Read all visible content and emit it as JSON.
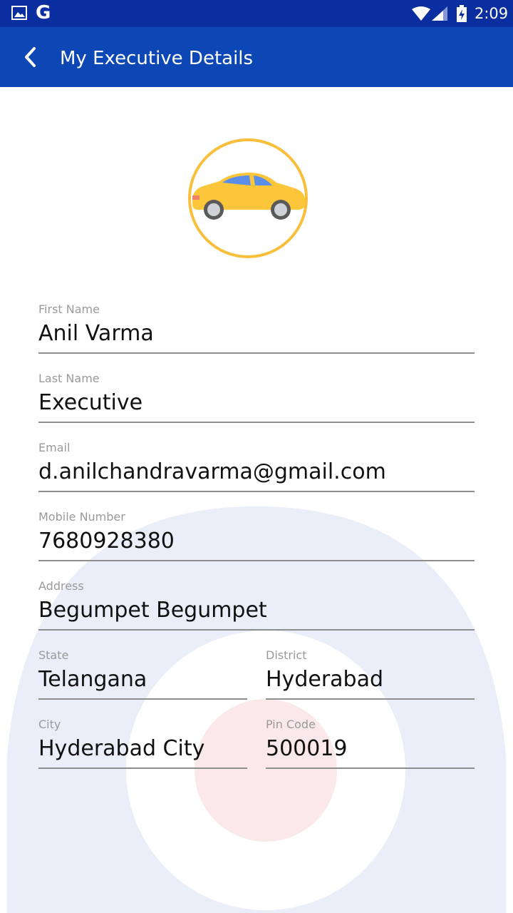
{
  "status_bar": {
    "time": "2:09",
    "icons": [
      "gallery-icon",
      "google-icon",
      "wifi-icon",
      "signal-icon",
      "battery-charging-icon"
    ],
    "google_letter": "G"
  },
  "app_bar": {
    "title": "My Executive Details",
    "back_icon": "chevron-left-icon",
    "color": "#0d47b5"
  },
  "avatar": {
    "icon": "car-icon",
    "ring_color": "#f9bf3b"
  },
  "fields": {
    "first_name": {
      "label": "First Name",
      "value": "Anil Varma"
    },
    "last_name": {
      "label": "Last Name",
      "value": "Executive"
    },
    "email": {
      "label": "Email",
      "value": "d.anilchandravarma@gmail.com"
    },
    "mobile": {
      "label": "Mobile Number",
      "value": "7680928380"
    },
    "address": {
      "label": "Address",
      "value": "Begumpet Begumpet"
    },
    "state": {
      "label": "State",
      "value": "Telangana"
    },
    "district": {
      "label": "District",
      "value": "Hyderabad"
    },
    "city": {
      "label": "City",
      "value": "Hyderabad City"
    },
    "pin_code": {
      "label": "Pin Code",
      "value": "500019"
    }
  }
}
